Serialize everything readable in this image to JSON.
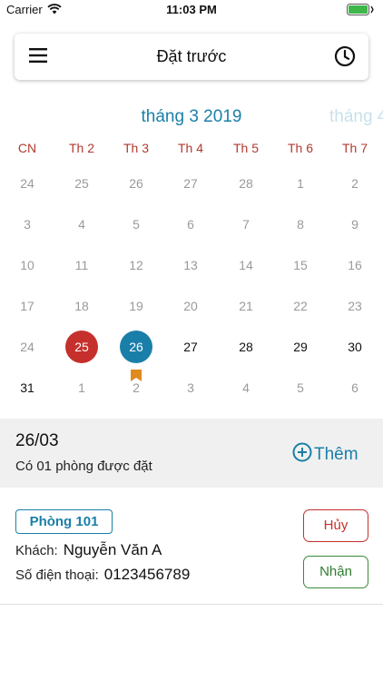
{
  "status_bar": {
    "carrier": "Carrier",
    "time": "11:03 PM"
  },
  "header": {
    "title": "Đặt trước",
    "menu_icon": "hamburger-icon",
    "history_icon": "clock-icon"
  },
  "calendar": {
    "month_label": "tháng 3 2019",
    "next_month_label": "tháng 4",
    "weekdays": [
      "CN",
      "Th 2",
      "Th 3",
      "Th 4",
      "Th 5",
      "Th 6",
      "Th 7"
    ],
    "weeks": [
      [
        {
          "d": "24",
          "m": "o"
        },
        {
          "d": "25",
          "m": "o"
        },
        {
          "d": "26",
          "m": "o"
        },
        {
          "d": "27",
          "m": "o"
        },
        {
          "d": "28",
          "m": "o"
        },
        {
          "d": "1",
          "m": "o"
        },
        {
          "d": "2",
          "m": "o"
        }
      ],
      [
        {
          "d": "3",
          "m": "o"
        },
        {
          "d": "4",
          "m": "o"
        },
        {
          "d": "5",
          "m": "o"
        },
        {
          "d": "6",
          "m": "o"
        },
        {
          "d": "7",
          "m": "o"
        },
        {
          "d": "8",
          "m": "o"
        },
        {
          "d": "9",
          "m": "o"
        }
      ],
      [
        {
          "d": "10",
          "m": "o"
        },
        {
          "d": "11",
          "m": "o"
        },
        {
          "d": "12",
          "m": "o"
        },
        {
          "d": "13",
          "m": "o"
        },
        {
          "d": "14",
          "m": "o"
        },
        {
          "d": "15",
          "m": "o"
        },
        {
          "d": "16",
          "m": "o"
        }
      ],
      [
        {
          "d": "17",
          "m": "o"
        },
        {
          "d": "18",
          "m": "o"
        },
        {
          "d": "19",
          "m": "o"
        },
        {
          "d": "20",
          "m": "o"
        },
        {
          "d": "21",
          "m": "o"
        },
        {
          "d": "22",
          "m": "o"
        },
        {
          "d": "23",
          "m": "o"
        }
      ],
      [
        {
          "d": "24",
          "m": "o"
        },
        {
          "d": "25",
          "m": "today"
        },
        {
          "d": "26",
          "m": "selected"
        },
        {
          "d": "27",
          "m": "c"
        },
        {
          "d": "28",
          "m": "c"
        },
        {
          "d": "29",
          "m": "c"
        },
        {
          "d": "30",
          "m": "c"
        }
      ],
      [
        {
          "d": "31",
          "m": "c"
        },
        {
          "d": "1",
          "m": "o"
        },
        {
          "d": "2",
          "m": "o"
        },
        {
          "d": "3",
          "m": "o"
        },
        {
          "d": "4",
          "m": "o"
        },
        {
          "d": "5",
          "m": "o"
        },
        {
          "d": "6",
          "m": "o"
        }
      ]
    ],
    "colors": {
      "today": "#c6302c",
      "selected": "#1a7fa8",
      "bookmark": "#e08a1e"
    }
  },
  "summary": {
    "date": "26/03",
    "count_text": "Có 01 phòng được đặt",
    "add_label": "Thêm"
  },
  "booking": {
    "room": "Phòng 101",
    "guest_label": "Khách:",
    "guest_name": "Nguyễn Văn A",
    "phone_label": "Số điện thoại:",
    "phone": "0123456789",
    "cancel_label": "Hủy",
    "accept_label": "Nhận"
  }
}
